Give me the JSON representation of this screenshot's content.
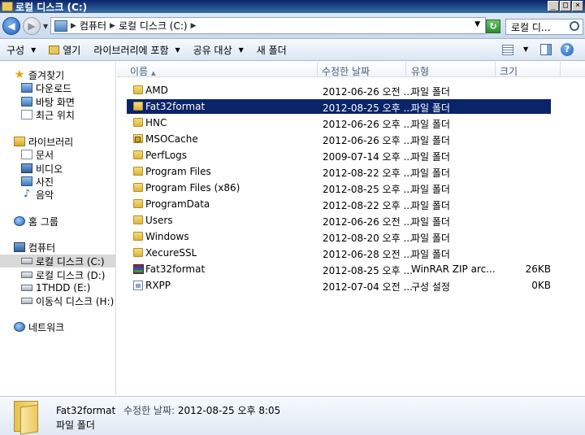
{
  "window": {
    "title": "로컬 디스크 (C:)",
    "buttons": {
      "minimize": "_",
      "maximize": "□",
      "close": "×"
    }
  },
  "address": {
    "crumbs": [
      "컴퓨터",
      "로컬 디스크 (C:)"
    ],
    "search_text": "로컬 디..."
  },
  "toolbar": {
    "organize": "구성",
    "open": "열기",
    "include_in_library": "라이브러리에 포함",
    "share_with": "공유 대상",
    "new_folder": "새 폴더"
  },
  "sidebar": {
    "favorites": {
      "label": "즐겨찾기",
      "items": [
        "다운로드",
        "바탕 화면",
        "최근 위치"
      ]
    },
    "libraries": {
      "label": "라이브러리",
      "items": [
        "문서",
        "비디오",
        "사진",
        "음악"
      ]
    },
    "homegroup": "홈 그룹",
    "computer": {
      "label": "컴퓨터",
      "items": [
        "로컬 디스크 (C:)",
        "로컬 디스크 (D:)",
        "1THDD (E:)",
        "이동식 디스크 (H:)"
      ]
    },
    "network": "네트워크"
  },
  "columns": {
    "name": "이름",
    "date": "수정한 날짜",
    "type": "유형",
    "size": "크기"
  },
  "files": [
    {
      "name": "AMD",
      "date": "2012-06-26 오전 ...",
      "type": "파일 폴더",
      "size": "",
      "icon": "folder-icon"
    },
    {
      "name": "Fat32format",
      "date": "2012-08-25 오후 ...",
      "type": "파일 폴더",
      "size": "",
      "icon": "folder-icon",
      "selected": true
    },
    {
      "name": "HNC",
      "date": "2012-06-26 오후 ...",
      "type": "파일 폴더",
      "size": "",
      "icon": "folder-icon"
    },
    {
      "name": "MSOCache",
      "date": "2012-06-26 오후 ...",
      "type": "파일 폴더",
      "size": "",
      "icon": "locked-folder-icon"
    },
    {
      "name": "PerfLogs",
      "date": "2009-07-14 오후 ...",
      "type": "파일 폴더",
      "size": "",
      "icon": "folder-icon"
    },
    {
      "name": "Program Files",
      "date": "2012-08-22 오후 ...",
      "type": "파일 폴더",
      "size": "",
      "icon": "folder-icon"
    },
    {
      "name": "Program Files (x86)",
      "date": "2012-08-25 오후 ...",
      "type": "파일 폴더",
      "size": "",
      "icon": "folder-icon"
    },
    {
      "name": "ProgramData",
      "date": "2012-08-22 오후 ...",
      "type": "파일 폴더",
      "size": "",
      "icon": "folder-icon"
    },
    {
      "name": "Users",
      "date": "2012-06-26 오전 ...",
      "type": "파일 폴더",
      "size": "",
      "icon": "folder-icon"
    },
    {
      "name": "Windows",
      "date": "2012-08-20 오후 ...",
      "type": "파일 폴더",
      "size": "",
      "icon": "folder-icon"
    },
    {
      "name": "XecureSSL",
      "date": "2012-06-28 오전 ...",
      "type": "파일 폴더",
      "size": "",
      "icon": "folder-icon"
    },
    {
      "name": "Fat32format",
      "date": "2012-08-25 오후 ...",
      "type": "WinRAR ZIP arc...",
      "size": "26KB",
      "icon": "winrar-archive-icon"
    },
    {
      "name": "RXPP",
      "date": "2012-07-04 오전 ...",
      "type": "구성 설정",
      "size": "0KB",
      "icon": "config-file-icon"
    }
  ],
  "details": {
    "name": "Fat32format",
    "modified_label": "수정한 날짜:",
    "modified_value": "2012-08-25 오후 8:05",
    "type": "파일 폴더"
  },
  "colors": {
    "selection": "#0a246a",
    "titlebar": "#0a246a"
  }
}
